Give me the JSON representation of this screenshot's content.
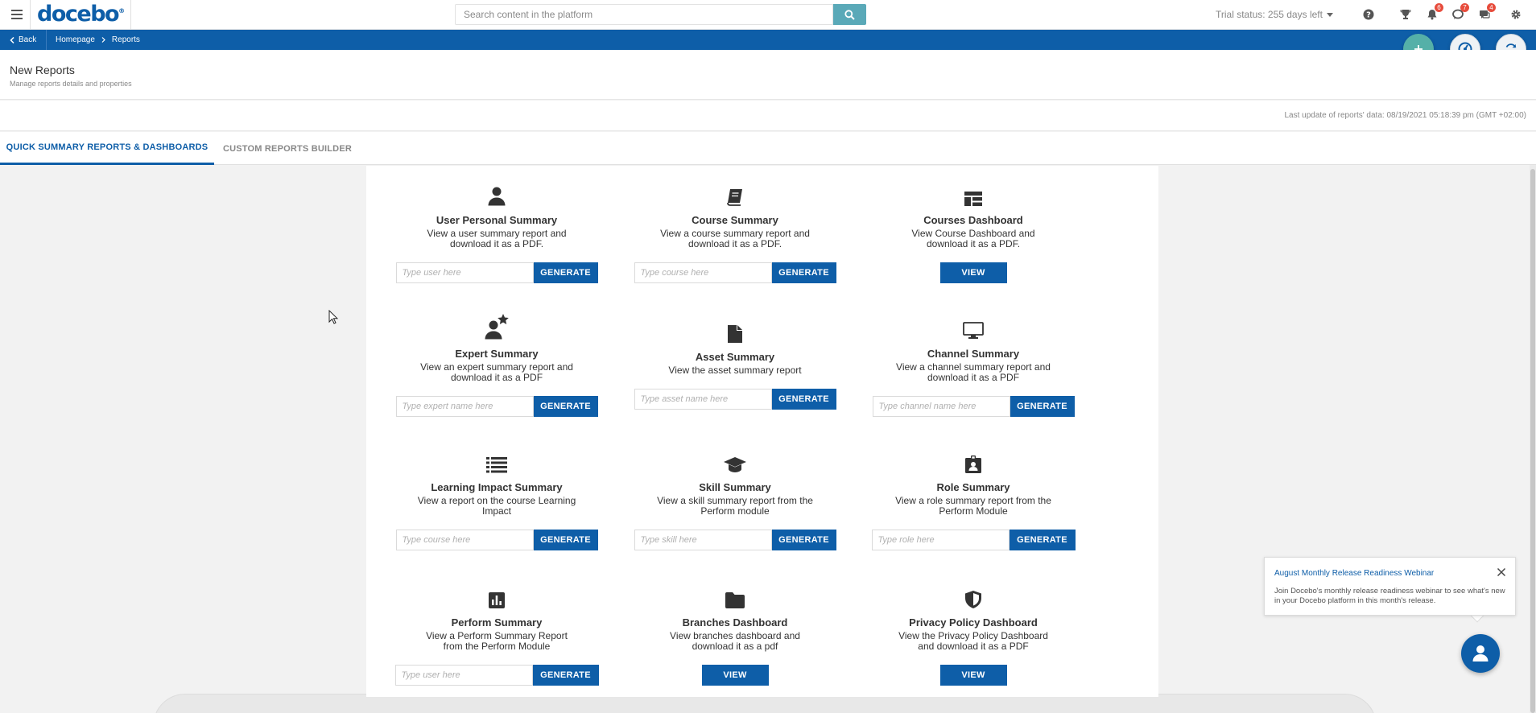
{
  "app": {
    "logo": "docebo",
    "logo_mark": "®"
  },
  "topbar": {
    "search_placeholder": "Search content in the platform",
    "trial_status": "Trial status: 255 days left",
    "badges": {
      "notifications": "6",
      "chat": "7",
      "messages": "4"
    }
  },
  "nav": {
    "back_label": "Back",
    "breadcrumbs": [
      "Homepage",
      "Reports"
    ]
  },
  "header": {
    "title": "New Reports",
    "subtitle": "Manage reports details and properties",
    "last_update": "Last update of reports' data: 08/19/2021 05:18:39 pm (GMT +02:00)"
  },
  "tabs": [
    {
      "label": "QUICK SUMMARY REPORTS & DASHBOARDS",
      "active": true
    },
    {
      "label": "CUSTOM REPORTS BUILDER",
      "active": false
    }
  ],
  "cards": [
    {
      "title": "User Personal Summary",
      "desc": "View a user summary report and download it as a PDF.",
      "placeholder": "Type user here",
      "button": "GENERATE",
      "icon": "user-icon"
    },
    {
      "title": "Course Summary",
      "desc": "View a course summary report and download it as a PDF.",
      "placeholder": "Type course here",
      "button": "GENERATE",
      "icon": "book-icon"
    },
    {
      "title": "Courses Dashboard",
      "desc": "View Course Dashboard and download it as a PDF.",
      "button": "VIEW",
      "icon": "dashboard-icon"
    },
    {
      "title": "Expert Summary",
      "desc": "View an expert summary report and download it as a PDF",
      "placeholder": "Type expert name here",
      "button": "GENERATE",
      "icon": "user-star-icon"
    },
    {
      "title": "Asset Summary",
      "desc": "View the asset summary report",
      "placeholder": "Type asset name here",
      "button": "GENERATE",
      "icon": "file-icon"
    },
    {
      "title": "Channel Summary",
      "desc": "View a channel summary report and download it as a PDF",
      "placeholder": "Type channel name here",
      "button": "GENERATE",
      "icon": "monitor-icon"
    },
    {
      "title": "Learning Impact Summary",
      "desc": "View a report on the course Learning Impact",
      "placeholder": "Type course here",
      "button": "GENERATE",
      "icon": "list-icon"
    },
    {
      "title": "Skill Summary",
      "desc": "View a skill summary report from the Perform module",
      "placeholder": "Type skill here",
      "button": "GENERATE",
      "icon": "graduation-cap-icon"
    },
    {
      "title": "Role Summary",
      "desc": "View a role summary report from the Perform Module",
      "placeholder": "Type role here",
      "button": "GENERATE",
      "icon": "id-badge-icon"
    },
    {
      "title": "Perform Summary",
      "desc": "View a Perform Summary Report from the Perform Module",
      "placeholder": "Type user here",
      "button": "GENERATE",
      "icon": "bar-chart-icon"
    },
    {
      "title": "Branches Dashboard",
      "desc": "View branches dashboard and download it as a pdf",
      "button": "VIEW",
      "icon": "folder-icon"
    },
    {
      "title": "Privacy Policy Dashboard",
      "desc": "View the Privacy Policy Dashboard and download it as a PDF",
      "button": "VIEW",
      "icon": "shield-icon"
    }
  ],
  "popup": {
    "title": "August Monthly Release Readiness Webinar",
    "body": "Join Docebo's monthly release readiness webinar to see what's new in your Docebo platform in this month's release."
  },
  "colors": {
    "brand": "#0e5ea8",
    "teal": "#55b0a8",
    "search_button": "#5aa9b8"
  }
}
